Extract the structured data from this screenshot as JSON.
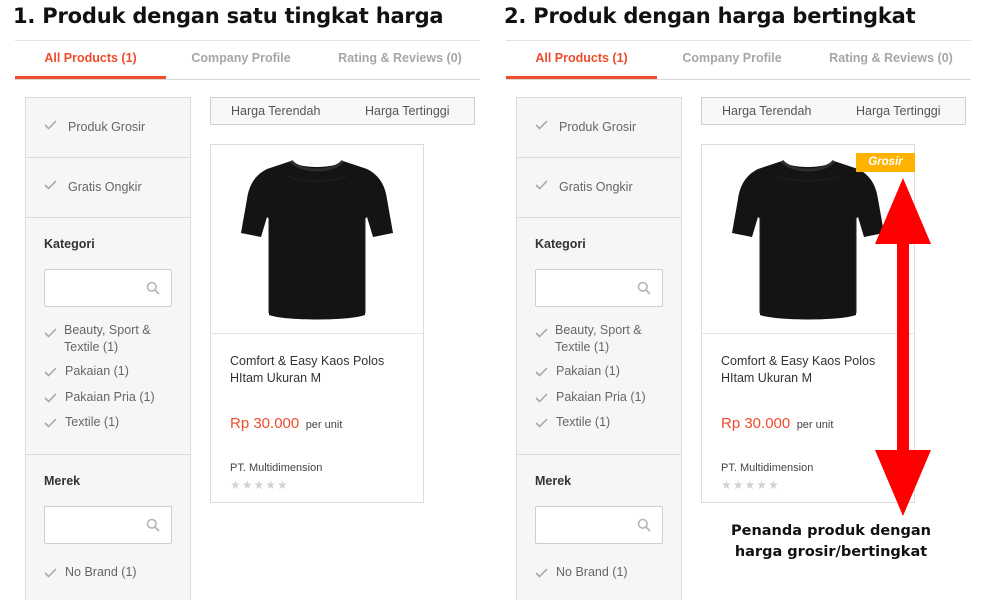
{
  "panels": [
    {
      "heading": "1. Produk dengan satu tingkat harga",
      "tabs": [
        "All Products (1)",
        "Company Profile",
        "Rating & Reviews (0)"
      ],
      "filters": [
        "Produk Grosir",
        "Gratis Ongkir"
      ],
      "kategori": {
        "title": "Kategori",
        "items": [
          "Beauty, Sport & Textile (1)",
          "Pakaian (1)",
          "Pakaian Pria (1)",
          "Textile (1)"
        ]
      },
      "merek": {
        "title": "Merek",
        "items": [
          "No Brand (1)"
        ]
      },
      "sort": [
        "Harga Terendah",
        "Harga Tertinggi"
      ],
      "product": {
        "name": "Comfort & Easy Kaos Polos HItam Ukuran M",
        "price": "Rp 30.000",
        "unit": "per unit",
        "seller": "PT. Multidimension",
        "stars": "★★★★★",
        "rating_filled": 0,
        "badge": ""
      }
    },
    {
      "heading": "2. Produk dengan harga bertingkat",
      "tabs": [
        "All Products (1)",
        "Company Profile",
        "Rating & Reviews (0)"
      ],
      "filters": [
        "Produk Grosir",
        "Gratis Ongkir"
      ],
      "kategori": {
        "title": "Kategori",
        "items": [
          "Beauty, Sport & Textile (1)",
          "Pakaian (1)",
          "Pakaian Pria (1)",
          "Textile (1)"
        ]
      },
      "merek": {
        "title": "Merek",
        "items": [
          "No Brand (1)"
        ]
      },
      "sort": [
        "Harga Terendah",
        "Harga Tertinggi"
      ],
      "product": {
        "name": "Comfort & Easy Kaos Polos HItam Ukuran M",
        "price": "Rp 30.000",
        "unit": "per unit",
        "seller": "PT. Multidimension",
        "stars": "★★★★★",
        "rating_filled": 0,
        "badge": "Grosir"
      }
    }
  ],
  "annotation": {
    "line1": "Penanda produk dengan",
    "line2": "harga grosir/bertingkat",
    "arrow_color": "#ff0000"
  },
  "colors": {
    "accent": "#ee4d2d",
    "badge": "#ffb300",
    "check": "#a8a8a8"
  }
}
